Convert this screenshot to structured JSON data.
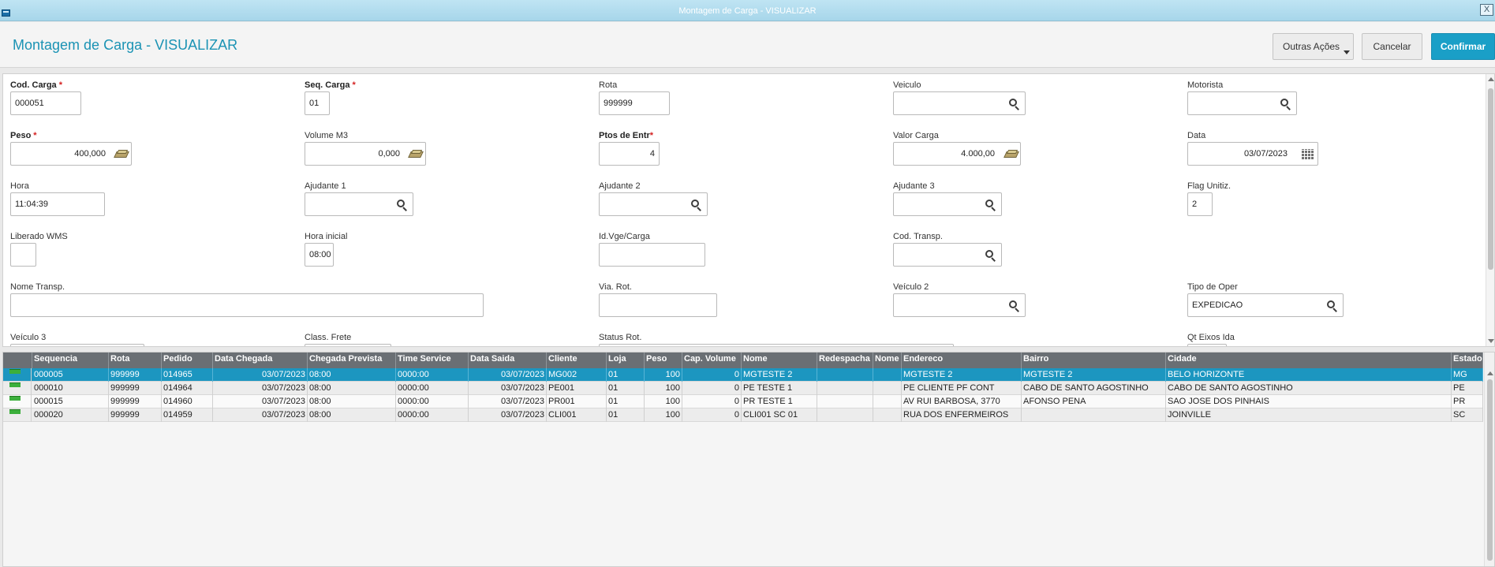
{
  "window": {
    "title": "Montagem de Carga - VISUALIZAR",
    "close_label": "X"
  },
  "header": {
    "title": "Montagem de Carga - VISUALIZAR",
    "outras_acoes": "Outras Ações",
    "cancelar": "Cancelar",
    "confirmar": "Confirmar"
  },
  "form": {
    "cod_carga": {
      "label": "Cod. Carga",
      "value": "000051"
    },
    "seq_carga": {
      "label": "Seq. Carga",
      "value": "01"
    },
    "rota": {
      "label": "Rota",
      "value": "999999"
    },
    "veiculo": {
      "label": "Veiculo",
      "value": ""
    },
    "motorista": {
      "label": "Motorista",
      "value": ""
    },
    "peso": {
      "label": "Peso",
      "value": "400,000"
    },
    "volume_m3": {
      "label": "Volume M3",
      "value": "0,000"
    },
    "ptos_entr": {
      "label": "Ptos de Entr",
      "value": "4"
    },
    "valor_carga": {
      "label": "Valor Carga",
      "value": "4.000,00"
    },
    "data": {
      "label": "Data",
      "value": "03/07/2023"
    },
    "hora": {
      "label": "Hora",
      "value": "11:04:39"
    },
    "ajudante1": {
      "label": "Ajudante 1",
      "value": ""
    },
    "ajudante2": {
      "label": "Ajudante 2",
      "value": ""
    },
    "ajudante3": {
      "label": "Ajudante 3",
      "value": ""
    },
    "flag_unitiz": {
      "label": "Flag Unitiz.",
      "value": "2"
    },
    "liberado_wms": {
      "label": "Liberado WMS",
      "value": ""
    },
    "hora_inicial": {
      "label": "Hora inicial",
      "value": "08:00"
    },
    "id_vge": {
      "label": "Id.Vge/Carga",
      "value": ""
    },
    "cod_transp": {
      "label": "Cod. Transp.",
      "value": ""
    },
    "nome_transp": {
      "label": "Nome Transp.",
      "value": ""
    },
    "via_rot": {
      "label": "Via. Rot.",
      "value": ""
    },
    "veiculo2": {
      "label": "Veículo 2",
      "value": ""
    },
    "tipo_oper": {
      "label": "Tipo de Oper",
      "value": "EXPEDICAO"
    },
    "veiculo3": {
      "label": "Veículo 3"
    },
    "class_frete": {
      "label": "Class. Frete"
    },
    "status_rot": {
      "label": "Status Rot."
    },
    "qt_eixos_ida": {
      "label": "Qt Eixos Ida"
    }
  },
  "grid": {
    "columns": [
      "Sequencia",
      "Rota",
      "Pedido",
      "Data Chegada",
      "Chegada Prevista",
      "Time Service",
      "Data Saida",
      "Cliente",
      "Loja",
      "Peso",
      "Cap. Volume",
      "Nome",
      "Redespacha",
      "Nome",
      "Endereco",
      "Bairro",
      "Cidade",
      "Estado"
    ],
    "rows": [
      [
        "000005",
        "999999",
        "014965",
        "03/07/2023",
        "08:00",
        "0000:00",
        "03/07/2023",
        "MG002",
        "01",
        "100",
        "0",
        "MGTESTE 2",
        "",
        "",
        "MGTESTE 2",
        "MGTESTE 2",
        "BELO HORIZONTE",
        "MG"
      ],
      [
        "000010",
        "999999",
        "014964",
        "03/07/2023",
        "08:00",
        "0000:00",
        "03/07/2023",
        "PE001",
        "01",
        "100",
        "0",
        "PE TESTE 1",
        "",
        "",
        "PE CLIENTE PF CONT",
        "CABO DE SANTO AGOSTINHO",
        "CABO DE SANTO AGOSTINHO",
        "PE"
      ],
      [
        "000015",
        "999999",
        "014960",
        "03/07/2023",
        "08:00",
        "0000:00",
        "03/07/2023",
        "PR001",
        "01",
        "100",
        "0",
        "PR TESTE 1",
        "",
        "",
        "AV RUI BARBOSA, 3770",
        "AFONSO PENA",
        "SAO JOSE DOS PINHAIS",
        "PR"
      ],
      [
        "000020",
        "999999",
        "014959",
        "03/07/2023",
        "08:00",
        "0000:00",
        "03/07/2023",
        "CLI001",
        "01",
        "100",
        "0",
        "CLI001 SC 01",
        "",
        "",
        "RUA DOS ENFERMEIROS",
        "",
        "JOINVILLE",
        "SC"
      ]
    ]
  },
  "colors": {
    "accent": "#1a9fc7",
    "selected_row": "#1c96c0",
    "grid_header": "#6a6f74"
  }
}
